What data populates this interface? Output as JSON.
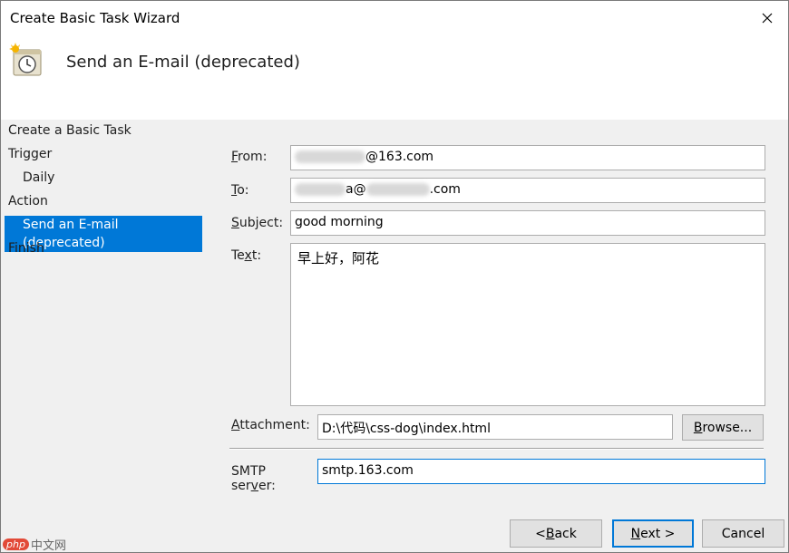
{
  "window": {
    "title": "Create Basic Task Wizard"
  },
  "header": {
    "title": "Send an E-mail (deprecated)"
  },
  "steps": [
    {
      "label": "Create a Basic Task"
    },
    {
      "label": "Trigger"
    },
    {
      "label": "Daily"
    },
    {
      "label": "Action"
    },
    {
      "label": "Send an E-mail (deprecated)"
    },
    {
      "label": "Finish"
    }
  ],
  "form": {
    "from_label_key": "F",
    "from_label_rest": "rom:",
    "from_value_suffix": "@163.com",
    "to_label_key": "T",
    "to_label_rest": "o:",
    "to_value_mid": "a@",
    "to_value_suffix": ".com",
    "subject_label_key": "S",
    "subject_label_rest": "ubject:",
    "subject_value": "good morning",
    "text_label_pre": "Te",
    "text_label_key": "x",
    "text_label_rest": "t:",
    "text_value": "早上好，阿花",
    "attachment_label_key": "A",
    "attachment_label_rest": "ttachment:",
    "attachment_value": "D:\\代码\\css-dog\\index.html",
    "browse_key": "B",
    "browse_rest": "rowse...",
    "smtp_label_pre": "SMTP ser",
    "smtp_label_key": "v",
    "smtp_label_rest": "er:",
    "smtp_value": "smtp.163.com"
  },
  "buttons": {
    "back_pre": "< ",
    "back_key": "B",
    "back_rest": "ack",
    "next_key": "N",
    "next_rest": "ext >",
    "cancel": "Cancel"
  },
  "watermark": {
    "logo": "php",
    "text": "中文网"
  },
  "colors": {
    "accent": "#0078d7",
    "selection_text": "#ffffff"
  }
}
